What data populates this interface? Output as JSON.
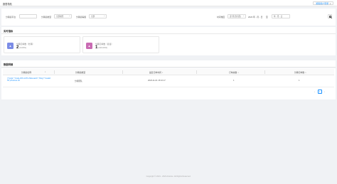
{
  "topbar": {
    "title": "报表导航",
    "account": "游客用户登录"
  },
  "filters": [
    {
      "label": "分销商平台",
      "value": ""
    },
    {
      "label": "分销商类型",
      "value": "全部类型"
    },
    {
      "label": "分销商等级",
      "value": "全部"
    }
  ],
  "date": {
    "label": "时间维度",
    "range_value": "近7天(含当天)",
    "start": "2023 年 - 月 - 日",
    "separator": "至",
    "end": "年 - 月 - 日"
  },
  "metrics_section": {
    "title": "实时指标"
  },
  "metrics": [
    {
      "label": "分销订单数（分销）",
      "value": "2",
      "sub": "(0.00%)",
      "icon": "chart-icon",
      "color": "#7b8ce6"
    },
    {
      "label": "分销订单数（直接）",
      "value": "1",
      "sub": "(100.00%)",
      "icon": "chart-icon",
      "color": "#c96bb3"
    }
  ],
  "table_section": {
    "title": "数据明细"
  },
  "columns": [
    "分销商名称",
    "分销商类型",
    "最近订单时间",
    "订单总数",
    "分销订单数"
  ],
  "rows": [
    {
      "name": "{\"Code\":\"Code.WX.AUTH.Mismatch\",\"Msg\":\"Invalid ID\"}-Partner-ID",
      "type": "分销团队",
      "time": "2023-11-01 15:16:17",
      "total": "1",
      "dist": "1"
    }
  ],
  "pagination": {
    "prev": "‹",
    "current": "1",
    "next": "›"
  },
  "footer": {
    "text": "Copyright © 2021 - 2023 Artstore. All Rights Reserved."
  }
}
